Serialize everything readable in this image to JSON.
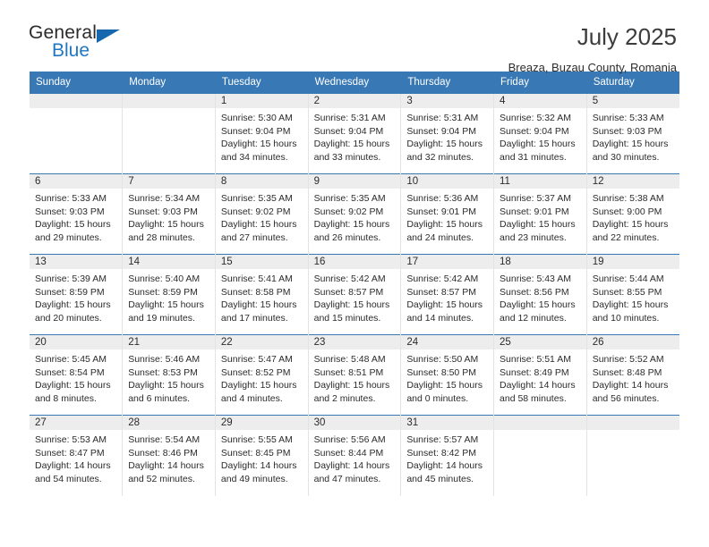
{
  "brand": {
    "name_primary": "General",
    "name_secondary": "Blue",
    "accent_color": "#1667ad",
    "triangle_icon": "triangle-icon"
  },
  "header": {
    "title": "July 2025",
    "subtitle": "Breaza, Buzau County, Romania"
  },
  "theme": {
    "header_band": "#3878b4",
    "day_band": "#ededed",
    "grid_line": "#e3e3e3",
    "row_line": "#3878b4",
    "text": "#2b2b2b"
  },
  "weekday_headers": [
    "Sunday",
    "Monday",
    "Tuesday",
    "Wednesday",
    "Thursday",
    "Friday",
    "Saturday"
  ],
  "labels": {
    "sunrise_prefix": "Sunrise:",
    "sunset_prefix": "Sunset:",
    "daylight_prefix": "Daylight:"
  },
  "weeks": [
    [
      {
        "day": "",
        "line1": "",
        "line2": "",
        "line3": "",
        "line4": "",
        "empty": true
      },
      {
        "day": "",
        "line1": "",
        "line2": "",
        "line3": "",
        "line4": "",
        "empty": true
      },
      {
        "day": "1",
        "line1": "Sunrise: 5:30 AM",
        "line2": "Sunset: 9:04 PM",
        "line3": "Daylight: 15 hours",
        "line4": "and 34 minutes."
      },
      {
        "day": "2",
        "line1": "Sunrise: 5:31 AM",
        "line2": "Sunset: 9:04 PM",
        "line3": "Daylight: 15 hours",
        "line4": "and 33 minutes."
      },
      {
        "day": "3",
        "line1": "Sunrise: 5:31 AM",
        "line2": "Sunset: 9:04 PM",
        "line3": "Daylight: 15 hours",
        "line4": "and 32 minutes."
      },
      {
        "day": "4",
        "line1": "Sunrise: 5:32 AM",
        "line2": "Sunset: 9:04 PM",
        "line3": "Daylight: 15 hours",
        "line4": "and 31 minutes."
      },
      {
        "day": "5",
        "line1": "Sunrise: 5:33 AM",
        "line2": "Sunset: 9:03 PM",
        "line3": "Daylight: 15 hours",
        "line4": "and 30 minutes."
      }
    ],
    [
      {
        "day": "6",
        "line1": "Sunrise: 5:33 AM",
        "line2": "Sunset: 9:03 PM",
        "line3": "Daylight: 15 hours",
        "line4": "and 29 minutes."
      },
      {
        "day": "7",
        "line1": "Sunrise: 5:34 AM",
        "line2": "Sunset: 9:03 PM",
        "line3": "Daylight: 15 hours",
        "line4": "and 28 minutes."
      },
      {
        "day": "8",
        "line1": "Sunrise: 5:35 AM",
        "line2": "Sunset: 9:02 PM",
        "line3": "Daylight: 15 hours",
        "line4": "and 27 minutes."
      },
      {
        "day": "9",
        "line1": "Sunrise: 5:35 AM",
        "line2": "Sunset: 9:02 PM",
        "line3": "Daylight: 15 hours",
        "line4": "and 26 minutes."
      },
      {
        "day": "10",
        "line1": "Sunrise: 5:36 AM",
        "line2": "Sunset: 9:01 PM",
        "line3": "Daylight: 15 hours",
        "line4": "and 24 minutes."
      },
      {
        "day": "11",
        "line1": "Sunrise: 5:37 AM",
        "line2": "Sunset: 9:01 PM",
        "line3": "Daylight: 15 hours",
        "line4": "and 23 minutes."
      },
      {
        "day": "12",
        "line1": "Sunrise: 5:38 AM",
        "line2": "Sunset: 9:00 PM",
        "line3": "Daylight: 15 hours",
        "line4": "and 22 minutes."
      }
    ],
    [
      {
        "day": "13",
        "line1": "Sunrise: 5:39 AM",
        "line2": "Sunset: 8:59 PM",
        "line3": "Daylight: 15 hours",
        "line4": "and 20 minutes."
      },
      {
        "day": "14",
        "line1": "Sunrise: 5:40 AM",
        "line2": "Sunset: 8:59 PM",
        "line3": "Daylight: 15 hours",
        "line4": "and 19 minutes."
      },
      {
        "day": "15",
        "line1": "Sunrise: 5:41 AM",
        "line2": "Sunset: 8:58 PM",
        "line3": "Daylight: 15 hours",
        "line4": "and 17 minutes."
      },
      {
        "day": "16",
        "line1": "Sunrise: 5:42 AM",
        "line2": "Sunset: 8:57 PM",
        "line3": "Daylight: 15 hours",
        "line4": "and 15 minutes."
      },
      {
        "day": "17",
        "line1": "Sunrise: 5:42 AM",
        "line2": "Sunset: 8:57 PM",
        "line3": "Daylight: 15 hours",
        "line4": "and 14 minutes."
      },
      {
        "day": "18",
        "line1": "Sunrise: 5:43 AM",
        "line2": "Sunset: 8:56 PM",
        "line3": "Daylight: 15 hours",
        "line4": "and 12 minutes."
      },
      {
        "day": "19",
        "line1": "Sunrise: 5:44 AM",
        "line2": "Sunset: 8:55 PM",
        "line3": "Daylight: 15 hours",
        "line4": "and 10 minutes."
      }
    ],
    [
      {
        "day": "20",
        "line1": "Sunrise: 5:45 AM",
        "line2": "Sunset: 8:54 PM",
        "line3": "Daylight: 15 hours",
        "line4": "and 8 minutes."
      },
      {
        "day": "21",
        "line1": "Sunrise: 5:46 AM",
        "line2": "Sunset: 8:53 PM",
        "line3": "Daylight: 15 hours",
        "line4": "and 6 minutes."
      },
      {
        "day": "22",
        "line1": "Sunrise: 5:47 AM",
        "line2": "Sunset: 8:52 PM",
        "line3": "Daylight: 15 hours",
        "line4": "and 4 minutes."
      },
      {
        "day": "23",
        "line1": "Sunrise: 5:48 AM",
        "line2": "Sunset: 8:51 PM",
        "line3": "Daylight: 15 hours",
        "line4": "and 2 minutes."
      },
      {
        "day": "24",
        "line1": "Sunrise: 5:50 AM",
        "line2": "Sunset: 8:50 PM",
        "line3": "Daylight: 15 hours",
        "line4": "and 0 minutes."
      },
      {
        "day": "25",
        "line1": "Sunrise: 5:51 AM",
        "line2": "Sunset: 8:49 PM",
        "line3": "Daylight: 14 hours",
        "line4": "and 58 minutes."
      },
      {
        "day": "26",
        "line1": "Sunrise: 5:52 AM",
        "line2": "Sunset: 8:48 PM",
        "line3": "Daylight: 14 hours",
        "line4": "and 56 minutes."
      }
    ],
    [
      {
        "day": "27",
        "line1": "Sunrise: 5:53 AM",
        "line2": "Sunset: 8:47 PM",
        "line3": "Daylight: 14 hours",
        "line4": "and 54 minutes."
      },
      {
        "day": "28",
        "line1": "Sunrise: 5:54 AM",
        "line2": "Sunset: 8:46 PM",
        "line3": "Daylight: 14 hours",
        "line4": "and 52 minutes."
      },
      {
        "day": "29",
        "line1": "Sunrise: 5:55 AM",
        "line2": "Sunset: 8:45 PM",
        "line3": "Daylight: 14 hours",
        "line4": "and 49 minutes."
      },
      {
        "day": "30",
        "line1": "Sunrise: 5:56 AM",
        "line2": "Sunset: 8:44 PM",
        "line3": "Daylight: 14 hours",
        "line4": "and 47 minutes."
      },
      {
        "day": "31",
        "line1": "Sunrise: 5:57 AM",
        "line2": "Sunset: 8:42 PM",
        "line3": "Daylight: 14 hours",
        "line4": "and 45 minutes."
      },
      {
        "day": "",
        "line1": "",
        "line2": "",
        "line3": "",
        "line4": "",
        "empty": true
      },
      {
        "day": "",
        "line1": "",
        "line2": "",
        "line3": "",
        "line4": "",
        "empty": true
      }
    ]
  ]
}
